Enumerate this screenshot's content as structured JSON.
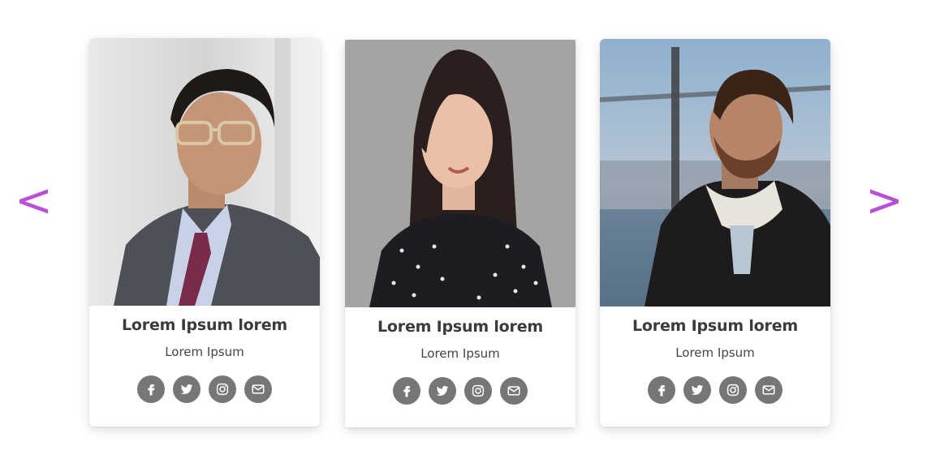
{
  "nav": {
    "prev_label": "<",
    "next_label": ">",
    "arrow_color": "#b84fd6"
  },
  "cards": [
    {
      "name": "Lorem Ipsum lorem",
      "role": "Lorem Ipsum",
      "social": [
        "facebook-icon",
        "twitter-icon",
        "instagram-icon",
        "mail-icon"
      ]
    },
    {
      "name": "Lorem Ipsum lorem",
      "role": "Lorem Ipsum",
      "social": [
        "facebook-icon",
        "twitter-icon",
        "instagram-icon",
        "mail-icon"
      ]
    },
    {
      "name": "Lorem Ipsum lorem",
      "role": "Lorem Ipsum",
      "social": [
        "facebook-icon",
        "twitter-icon",
        "instagram-icon",
        "mail-icon"
      ]
    }
  ],
  "colors": {
    "social_button": "#767676",
    "name_text": "#3b3b3b",
    "role_text": "#444444"
  }
}
